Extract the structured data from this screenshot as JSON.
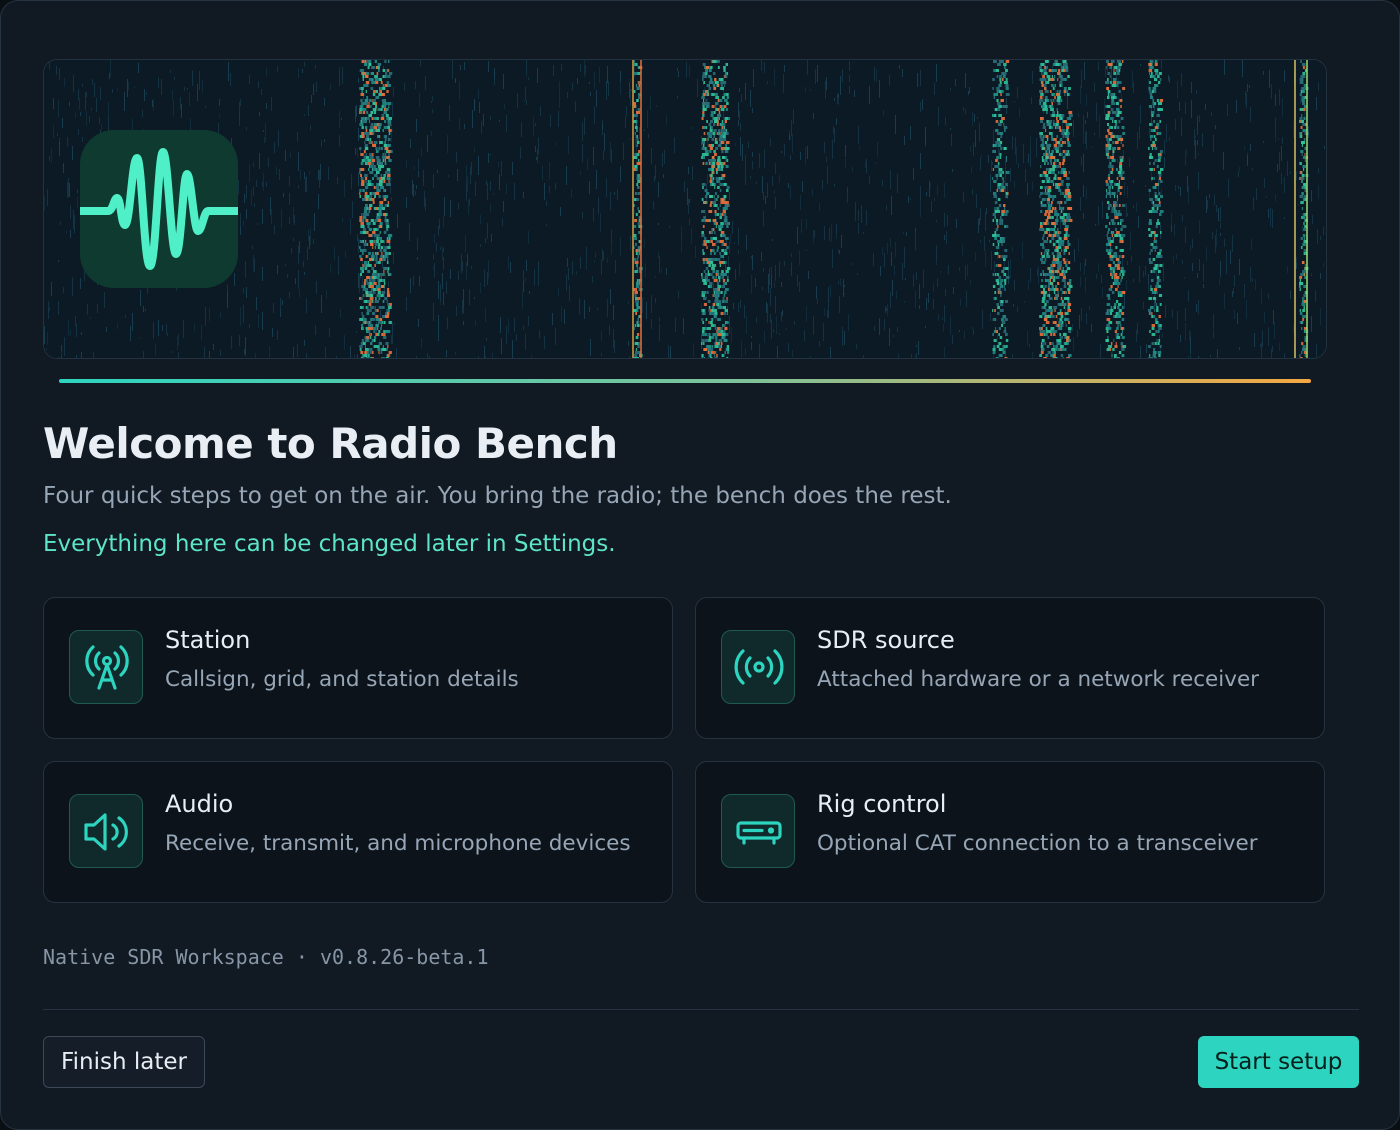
{
  "hero": {
    "app_icon": "waveform-icon",
    "accent_colors": [
      "#2dd4bf",
      "#f5a742"
    ]
  },
  "header": {
    "title": "Welcome to Radio Bench",
    "subtitle": "Four quick steps to get on the air. You bring the radio; the bench does the rest.",
    "hint": "Everything here can be changed later in Settings."
  },
  "steps": [
    {
      "icon": "antenna-tower-icon",
      "title": "Station",
      "description": "Callsign, grid, and station details"
    },
    {
      "icon": "broadcast-icon",
      "title": "SDR source",
      "description": "Attached hardware or a network receiver"
    },
    {
      "icon": "speaker-icon",
      "title": "Audio",
      "description": "Receive, transmit, and microphone devices"
    },
    {
      "icon": "radio-device-icon",
      "title": "Rig control",
      "description": "Optional CAT connection to a transceiver"
    }
  ],
  "footer": {
    "version": "Native SDR Workspace · v0.8.26-beta.1",
    "finish_later_label": "Finish later",
    "start_setup_label": "Start setup"
  },
  "colors": {
    "accent": "#2dd4bf",
    "background": "#111922",
    "card": "#0c131a",
    "hint_text": "#5ce5c8"
  }
}
